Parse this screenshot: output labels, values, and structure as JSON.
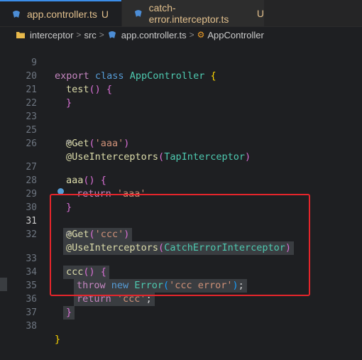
{
  "tabs": [
    {
      "name": "app.controller.ts",
      "status": "U",
      "icon": "nestjs-icon",
      "active": true
    },
    {
      "name": "catch-error.interceptor.ts",
      "status": "U",
      "icon": "nestjs-icon",
      "active": false
    }
  ],
  "breadcrumb": {
    "folder": "interceptor",
    "sub": "src",
    "file": "app.controller.ts",
    "symbol": "AppController"
  },
  "lines": [
    {
      "num": "9"
    },
    {
      "num": "20"
    },
    {
      "num": "21"
    },
    {
      "num": "22"
    },
    {
      "num": "23"
    },
    {
      "num": "25"
    },
    {
      "num": "26"
    },
    {
      "num": "27"
    },
    {
      "num": "28"
    },
    {
      "num": "29"
    },
    {
      "num": "30"
    },
    {
      "num": "31"
    },
    {
      "num": "32"
    },
    {
      "num": "33"
    },
    {
      "num": "34"
    },
    {
      "num": "35"
    },
    {
      "num": "36"
    },
    {
      "num": "37"
    },
    {
      "num": "38"
    }
  ],
  "code": {
    "export_kw": "export",
    "class_kw": "class",
    "class_name": "AppController",
    "test_fn": "test",
    "get_dec": "@Get",
    "aaa_str": "'aaa'",
    "use_interceptors": "@UseInterceptors",
    "tap_interceptor": "TapInterceptor",
    "aaa_fn": "aaa",
    "return_kw": "return",
    "ccc_str": "'ccc'",
    "catch_error_interceptor": "CatchErrorInterceptor",
    "ccc_fn": "ccc",
    "throw_kw": "throw",
    "new_kw": "new",
    "error_cls": "Error",
    "ccc_error_str": "'ccc error'"
  },
  "colors": {
    "accent": "#3b8eea",
    "highlight_border": "#e5252b",
    "modified": "#e2c08d"
  }
}
